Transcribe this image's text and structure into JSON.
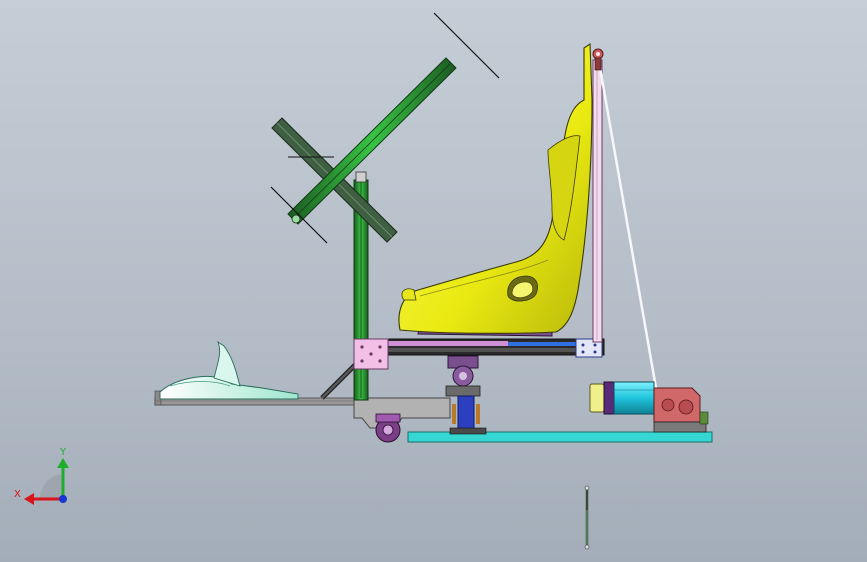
{
  "viewport": {
    "background_top": "#c5cdd6",
    "background_bottom": "#a3adb9"
  },
  "triad": {
    "x_label": "X",
    "y_label": "Y",
    "x_color": "#d8141c",
    "y_color": "#1fae2a",
    "z_color": "#1a35d0"
  },
  "colors": {
    "profile_green": "#2fb83a",
    "profile_dark": "#1d5f24",
    "seat_yellow": "#f1f21e",
    "seat_base_purple": "#7a4f8e",
    "plate_pink": "#f2bfe6",
    "base_cyan": "#35d7d2",
    "motor_cyan": "#21c6de",
    "gearbox_red": "#d0686a",
    "pedal_white": "#f2f4f4",
    "pedal_mint": "#a8ead7",
    "rail_gray": "#8c8c8c",
    "actuator_blue": "#2c3fbf"
  }
}
